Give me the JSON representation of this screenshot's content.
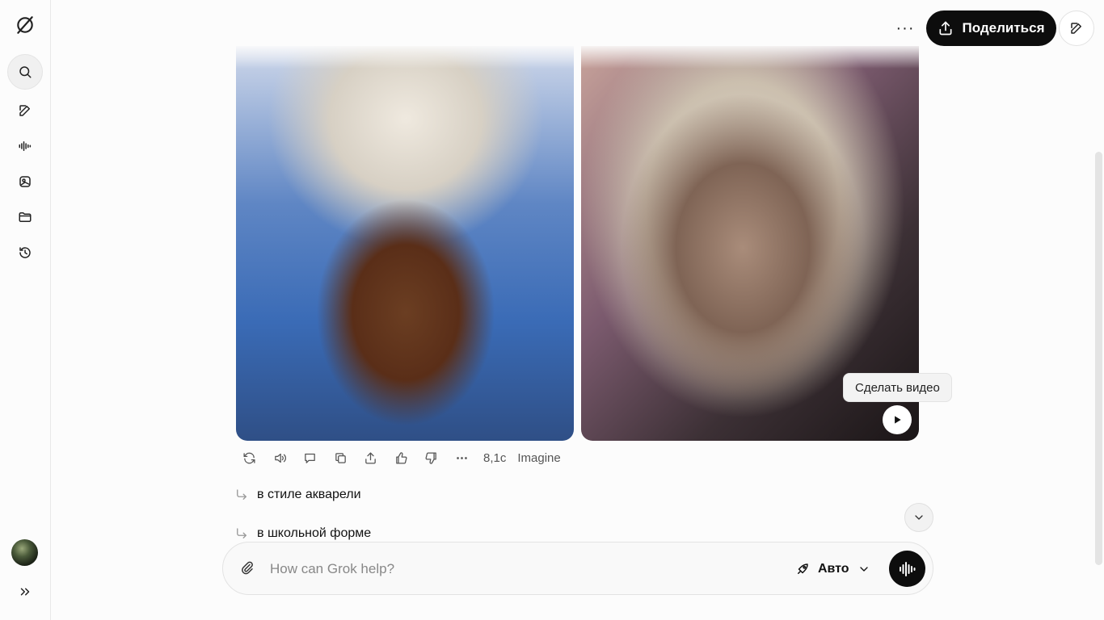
{
  "header": {
    "more_label": "···",
    "share_label": "Поделиться"
  },
  "sidebar": {
    "icons": [
      "grok-logo-icon",
      "search-icon",
      "new-chat-icon",
      "voice-icon",
      "imagine-icon",
      "projects-folder-icon",
      "history-icon",
      "expand-sidebar-icon"
    ]
  },
  "message": {
    "tooltip": "Сделать видео",
    "response_time": "8,1с",
    "model_label": "Imagine"
  },
  "suggestions": [
    {
      "label": "в стиле акварели"
    },
    {
      "label": "в школьной форме"
    }
  ],
  "composer": {
    "placeholder": "How can Grok help?",
    "mode_label": "Авто"
  }
}
